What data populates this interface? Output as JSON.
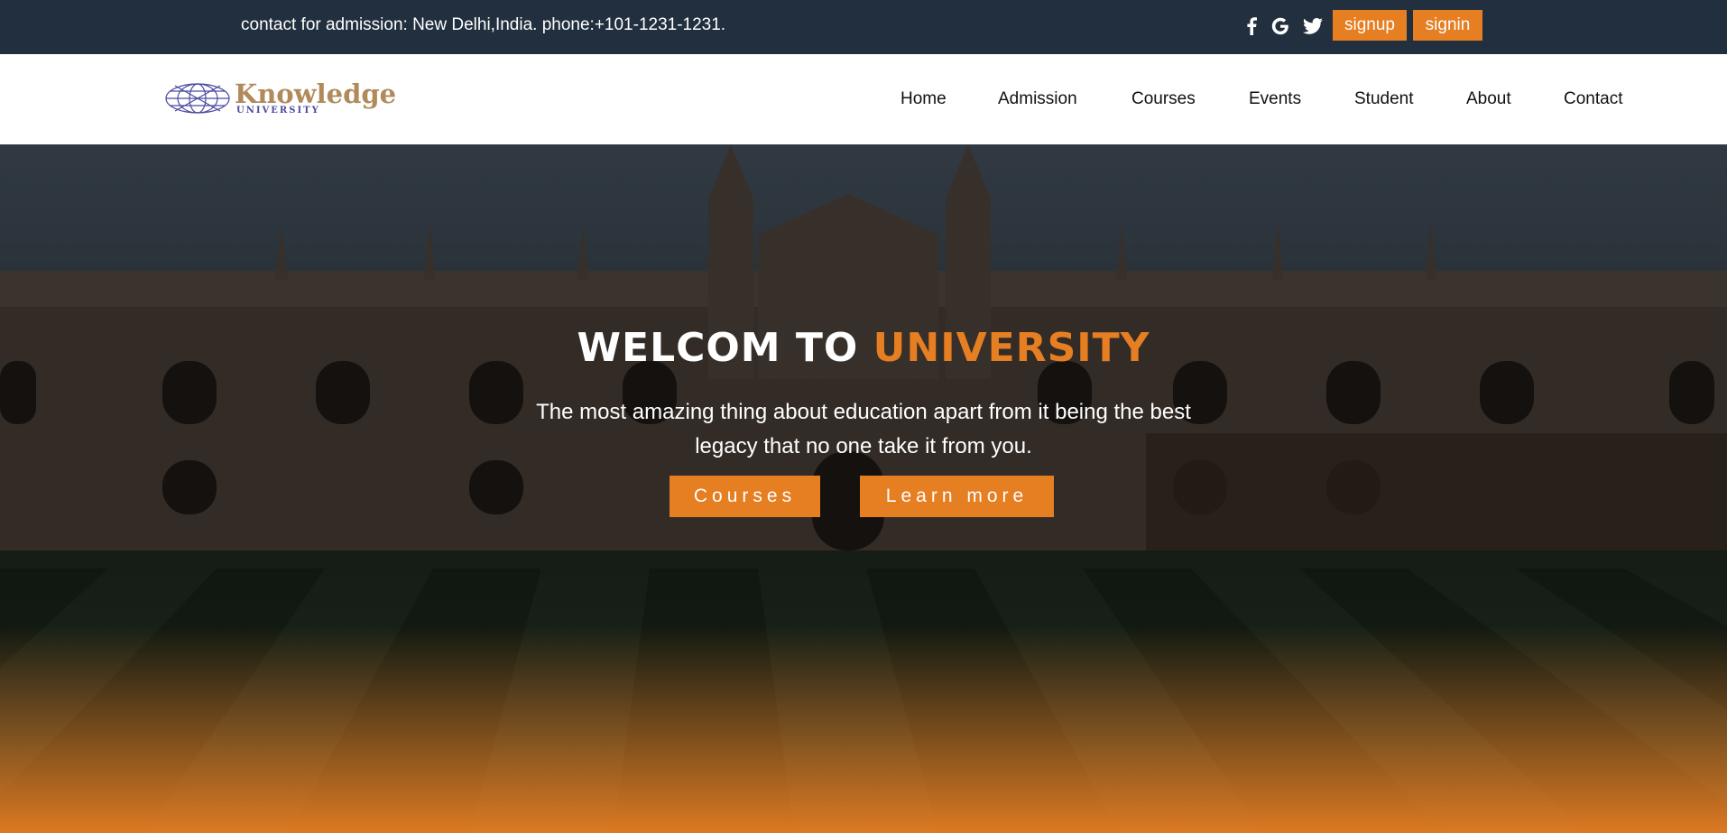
{
  "topbar": {
    "contact_text": "contact for admission: New Delhi,India. phone:+101-1231-1231.",
    "social_icons": [
      "facebook-icon",
      "google-icon",
      "twitter-icon"
    ],
    "signup_label": "signup",
    "signin_label": "signin"
  },
  "logo": {
    "main": "Knowledge",
    "sub": "UNIVERSITY"
  },
  "nav": {
    "items": [
      "Home",
      "Admission",
      "Courses",
      "Events",
      "Student",
      "About",
      "Contact"
    ]
  },
  "hero": {
    "title_part1": "WELCOM TO",
    "title_part2": "UNIVERSITY",
    "subtitle": "The most amazing thing about education apart from it being the best legacy that no one take it from you.",
    "courses_button": "Courses",
    "learn_more_button": "Learn more"
  },
  "colors": {
    "topbar_bg": "#222f3e",
    "accent": "#e67e22",
    "nav_text": "#111111"
  }
}
